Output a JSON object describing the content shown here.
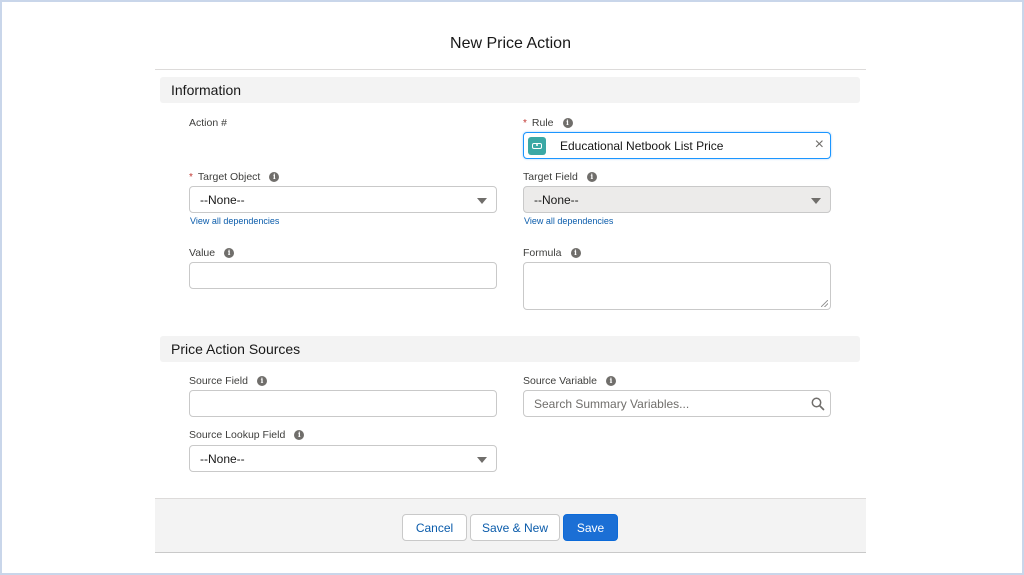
{
  "modal": {
    "title": "New Price Action",
    "sections": {
      "information": {
        "title": "Information",
        "action_number": {
          "label": "Action #"
        },
        "rule": {
          "label": "Rule",
          "required": true,
          "value": "Educational Netbook List Price",
          "icon": "price-rule-icon",
          "clear_icon": "×"
        },
        "target_object": {
          "label": "Target Object",
          "required": true,
          "value": "--None--",
          "link": "View all dependencies"
        },
        "target_field": {
          "label": "Target Field",
          "value": "--None--",
          "disabled": true,
          "link": "View all dependencies"
        },
        "value": {
          "label": "Value",
          "value": ""
        },
        "formula": {
          "label": "Formula",
          "value": ""
        }
      },
      "sources": {
        "title": "Price Action Sources",
        "source_field": {
          "label": "Source Field",
          "value": ""
        },
        "source_variable": {
          "label": "Source Variable",
          "placeholder": "Search Summary Variables..."
        },
        "source_lookup_field": {
          "label": "Source Lookup Field",
          "value": "--None--"
        }
      }
    },
    "footer": {
      "cancel_label": "Cancel",
      "save_new_label": "Save & New",
      "save_label": "Save"
    },
    "required_marker": "*",
    "info_glyph": "i"
  },
  "colors": {
    "brand": "#1b6fd5",
    "link": "#0b5cab",
    "required": "#c23934",
    "rule_icon": "#3ba8a5",
    "section_bg": "#f3f3f3"
  }
}
